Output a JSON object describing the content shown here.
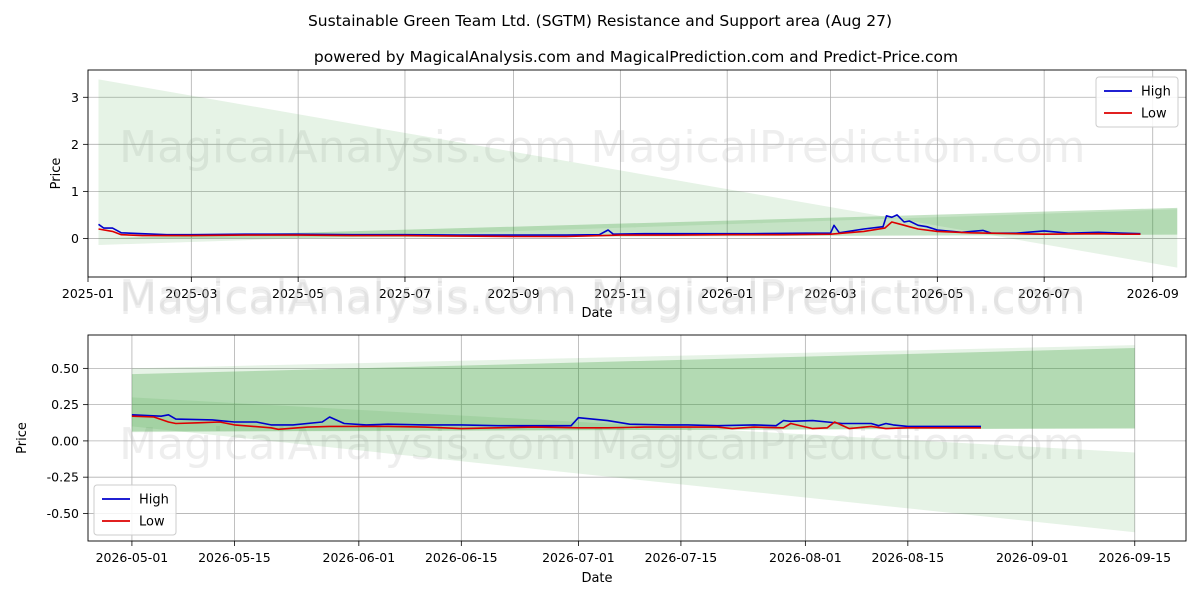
{
  "title": "Sustainable Green Team Ltd. (SGTM) Resistance and Support area (Aug 27)",
  "subtitle": "powered by MagicalAnalysis.com and MagicalPrediction.com and Predict-Price.com",
  "watermarks": [
    "MagicalAnalysis.com",
    "MagicalPrediction.com"
  ],
  "colors": {
    "high": "#0000cc",
    "low": "#dd0000",
    "band_light": "#2e9b2e",
    "band_dark": "#2e9b2e"
  },
  "chart_data": [
    {
      "type": "line",
      "xlabel": "Date",
      "ylabel": "Price",
      "xlim": [
        "2025-01-01",
        "2026-09-20"
      ],
      "ylim": [
        -0.82,
        3.58
      ],
      "x_ticks": [
        "2025-01",
        "2025-03",
        "2025-05",
        "2025-07",
        "2025-09",
        "2025-11",
        "2026-01",
        "2026-03",
        "2026-05",
        "2026-07",
        "2026-09"
      ],
      "y_ticks": [
        0,
        1,
        2,
        3
      ],
      "legend": {
        "placement": "top-right",
        "entries": [
          "High",
          "Low"
        ]
      },
      "grid": true,
      "bands": [
        {
          "kind": "light",
          "x": [
            "2025-01-07",
            "2026-09-15"
          ],
          "top": [
            3.38,
            -0.62
          ],
          "bottom": [
            -0.14,
            0.62
          ]
        },
        {
          "kind": "dark",
          "x": [
            "2025-01-07",
            "2026-09-15"
          ],
          "top": [
            0.0,
            0.65
          ],
          "bottom": [
            0.0,
            0.08
          ]
        }
      ],
      "series": [
        {
          "name": "High",
          "x": [
            "2025-01-07",
            "2025-01-10",
            "2025-01-15",
            "2025-01-20",
            "2025-02-01",
            "2025-02-15",
            "2025-03-01",
            "2025-04-01",
            "2025-05-01",
            "2025-06-01",
            "2025-07-01",
            "2025-08-01",
            "2025-09-01",
            "2025-10-01",
            "2025-10-20",
            "2025-10-25",
            "2025-10-28",
            "2025-11-15",
            "2025-12-15",
            "2026-01-15",
            "2026-02-15",
            "2026-03-01",
            "2026-03-03",
            "2026-03-06",
            "2026-03-20",
            "2026-03-31",
            "2026-04-02",
            "2026-04-05",
            "2026-04-08",
            "2026-04-12",
            "2026-04-15",
            "2026-04-20",
            "2026-04-25",
            "2026-05-01",
            "2026-05-15",
            "2026-05-27",
            "2026-06-01",
            "2026-06-15",
            "2026-07-01",
            "2026-07-15",
            "2026-08-01",
            "2026-08-15",
            "2026-08-25"
          ],
          "values": [
            0.3,
            0.22,
            0.22,
            0.12,
            0.1,
            0.08,
            0.08,
            0.09,
            0.09,
            0.08,
            0.08,
            0.07,
            0.07,
            0.07,
            0.08,
            0.18,
            0.09,
            0.1,
            0.1,
            0.1,
            0.11,
            0.11,
            0.28,
            0.12,
            0.2,
            0.25,
            0.48,
            0.45,
            0.5,
            0.35,
            0.37,
            0.28,
            0.25,
            0.18,
            0.13,
            0.17,
            0.11,
            0.11,
            0.16,
            0.11,
            0.13,
            0.11,
            0.1
          ]
        },
        {
          "name": "Low",
          "x": [
            "2025-01-07",
            "2025-01-15",
            "2025-01-20",
            "2025-02-01",
            "2025-03-01",
            "2025-04-01",
            "2025-05-01",
            "2025-06-01",
            "2025-07-01",
            "2025-08-01",
            "2025-09-01",
            "2025-10-01",
            "2025-11-01",
            "2025-12-01",
            "2026-01-01",
            "2026-02-01",
            "2026-03-01",
            "2026-03-20",
            "2026-04-01",
            "2026-04-05",
            "2026-04-10",
            "2026-04-15",
            "2026-04-20",
            "2026-05-01",
            "2026-05-20",
            "2026-06-15",
            "2026-07-01",
            "2026-08-01",
            "2026-08-15",
            "2026-08-25"
          ],
          "values": [
            0.2,
            0.15,
            0.08,
            0.06,
            0.06,
            0.07,
            0.07,
            0.06,
            0.06,
            0.05,
            0.04,
            0.04,
            0.07,
            0.07,
            0.08,
            0.08,
            0.09,
            0.15,
            0.22,
            0.35,
            0.3,
            0.25,
            0.2,
            0.15,
            0.12,
            0.1,
            0.09,
            0.1,
            0.09,
            0.09
          ]
        }
      ]
    },
    {
      "type": "line",
      "xlabel": "Date",
      "ylabel": "Price",
      "xlim": [
        "2026-04-25",
        "2026-09-22"
      ],
      "ylim": [
        -0.69,
        0.73
      ],
      "x_ticks": [
        "2026-05-01",
        "2026-05-15",
        "2026-06-01",
        "2026-06-15",
        "2026-07-01",
        "2026-07-15",
        "2026-08-01",
        "2026-08-15",
        "2026-09-01",
        "2026-09-15"
      ],
      "y_ticks": [
        -0.5,
        -0.25,
        0.0,
        0.25,
        0.5
      ],
      "legend": {
        "placement": "bottom-left",
        "entries": [
          "High",
          "Low"
        ]
      },
      "grid": true,
      "bands": [
        {
          "kind": "light",
          "x": [
            "2026-05-01",
            "2026-09-15"
          ],
          "top": [
            0.5,
            0.66
          ],
          "bottom": [
            0.06,
            0.09
          ]
        },
        {
          "kind": "light",
          "x": [
            "2026-05-01",
            "2026-09-15"
          ],
          "top": [
            0.3,
            -0.08
          ],
          "bottom": [
            0.1,
            -0.63
          ]
        },
        {
          "kind": "dark",
          "x": [
            "2026-05-01",
            "2026-09-15"
          ],
          "top": [
            0.46,
            0.64
          ],
          "bottom": [
            0.065,
            0.085
          ]
        }
      ],
      "series": [
        {
          "name": "High",
          "x": [
            "2026-05-01",
            "2026-05-05",
            "2026-05-06",
            "2026-05-07",
            "2026-05-12",
            "2026-05-15",
            "2026-05-18",
            "2026-05-20",
            "2026-05-23",
            "2026-05-27",
            "2026-05-28",
            "2026-05-30",
            "2026-06-02",
            "2026-06-05",
            "2026-06-10",
            "2026-06-15",
            "2026-06-20",
            "2026-06-25",
            "2026-06-30",
            "2026-07-01",
            "2026-07-05",
            "2026-07-08",
            "2026-07-13",
            "2026-07-16",
            "2026-07-20",
            "2026-07-25",
            "2026-07-28",
            "2026-07-29",
            "2026-07-30",
            "2026-08-02",
            "2026-08-04",
            "2026-08-06",
            "2026-08-10",
            "2026-08-11",
            "2026-08-12",
            "2026-08-13",
            "2026-08-15",
            "2026-08-20",
            "2026-08-25"
          ],
          "values": [
            0.18,
            0.17,
            0.18,
            0.15,
            0.145,
            0.13,
            0.13,
            0.11,
            0.11,
            0.13,
            0.165,
            0.12,
            0.11,
            0.115,
            0.11,
            0.11,
            0.105,
            0.105,
            0.105,
            0.16,
            0.14,
            0.115,
            0.11,
            0.11,
            0.105,
            0.11,
            0.105,
            0.14,
            0.135,
            0.14,
            0.13,
            0.12,
            0.12,
            0.105,
            0.12,
            0.11,
            0.1,
            0.1,
            0.1
          ]
        },
        {
          "name": "Low",
          "x": [
            "2026-05-01",
            "2026-05-04",
            "2026-05-06",
            "2026-05-07",
            "2026-05-10",
            "2026-05-13",
            "2026-05-15",
            "2026-05-20",
            "2026-05-21",
            "2026-05-25",
            "2026-05-28",
            "2026-06-01",
            "2026-06-05",
            "2026-06-10",
            "2026-06-15",
            "2026-06-20",
            "2026-06-25",
            "2026-07-01",
            "2026-07-05",
            "2026-07-10",
            "2026-07-20",
            "2026-07-22",
            "2026-07-25",
            "2026-07-29",
            "2026-07-30",
            "2026-08-02",
            "2026-08-04",
            "2026-08-05",
            "2026-08-07",
            "2026-08-10",
            "2026-08-12",
            "2026-08-15",
            "2026-08-20",
            "2026-08-25"
          ],
          "values": [
            0.17,
            0.165,
            0.13,
            0.12,
            0.125,
            0.13,
            0.11,
            0.09,
            0.08,
            0.095,
            0.1,
            0.1,
            0.1,
            0.095,
            0.085,
            0.09,
            0.095,
            0.09,
            0.09,
            0.095,
            0.095,
            0.085,
            0.095,
            0.09,
            0.12,
            0.085,
            0.09,
            0.13,
            0.085,
            0.1,
            0.085,
            0.09,
            0.09,
            0.09
          ]
        }
      ]
    }
  ]
}
